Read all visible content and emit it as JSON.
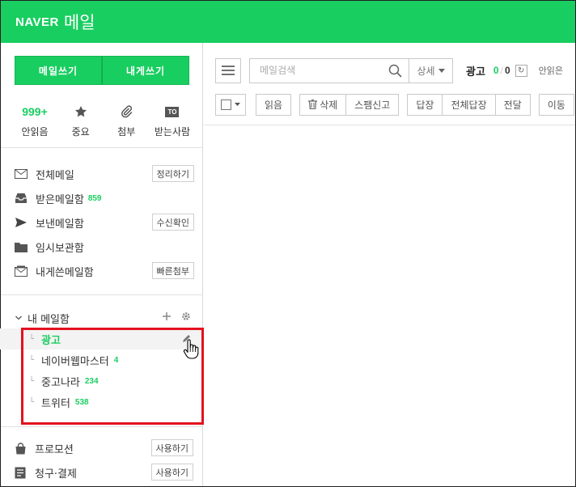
{
  "header": {
    "logo_naver": "NAVER",
    "logo_mail": "메일"
  },
  "sidebar": {
    "compose": {
      "write_label": "메일쓰기",
      "self_label": "내게쓰기"
    },
    "quick": [
      {
        "count": "999+",
        "label": "안읽음"
      },
      {
        "icon": "star-icon",
        "label": "중요"
      },
      {
        "icon": "paperclip-icon",
        "label": "첨부"
      },
      {
        "icon_text": "TO",
        "label": "받는사람"
      }
    ],
    "folders": [
      {
        "icon": "envelope-icon",
        "name": "전체메일",
        "button": "정리하기"
      },
      {
        "icon": "inbox-icon",
        "name": "받은메일함",
        "count": "859"
      },
      {
        "icon": "send-icon",
        "name": "보낸메일함",
        "button": "수신확인"
      },
      {
        "icon": "folder-icon",
        "name": "임시보관함"
      },
      {
        "icon": "self-mail-icon",
        "name": "내게쓴메일함",
        "button": "빠른첨부"
      }
    ],
    "mybox": {
      "title": "내 메일함",
      "subfolders": [
        {
          "name": "광고",
          "count": "",
          "active": true
        },
        {
          "name": "네이버웹마스터",
          "count": "4"
        },
        {
          "name": "중고나라",
          "count": "234"
        },
        {
          "name": "트위터",
          "count": "538"
        }
      ]
    },
    "extras": [
      {
        "icon": "shopping-bag-icon",
        "name": "프로모션",
        "button": "사용하기"
      },
      {
        "icon": "bill-icon",
        "name": "청구·결제",
        "button": "사용하기"
      }
    ]
  },
  "main": {
    "search": {
      "placeholder": "메일검색",
      "detail": "상세"
    },
    "folder_title": "광고",
    "unread": "0",
    "total": "0",
    "unread_link": "안읽은",
    "toolbar": {
      "read": "읽음",
      "delete": "삭제",
      "spam": "스팸신고",
      "reply": "답장",
      "reply_all": "전체답장",
      "forward": "전달",
      "move": "이동"
    }
  },
  "colors": {
    "brand_green": "#19ce60",
    "highlight_red": "#e3121e"
  }
}
